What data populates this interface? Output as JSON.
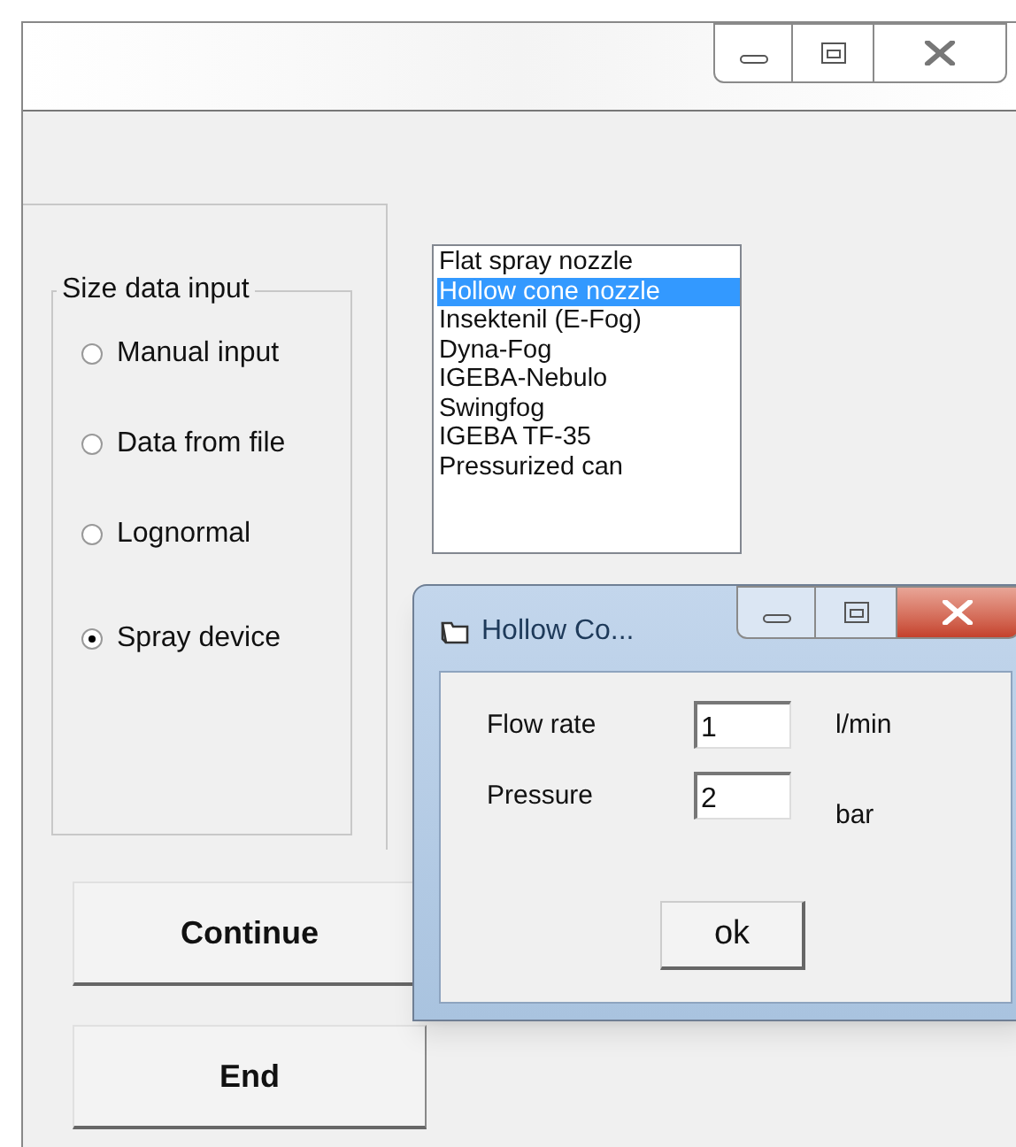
{
  "group": {
    "title": "Size data input",
    "options": [
      {
        "label": "Manual input",
        "selected": false
      },
      {
        "label": "Data from file",
        "selected": false
      },
      {
        "label": "Lognormal",
        "selected": false
      },
      {
        "label": "Spray device",
        "selected": true
      }
    ]
  },
  "list": {
    "items": [
      {
        "label": "Flat spray nozzle",
        "selected": false
      },
      {
        "label": "Hollow cone nozzle",
        "selected": true
      },
      {
        "label": "Insektenil (E-Fog)",
        "selected": false
      },
      {
        "label": "Dyna-Fog",
        "selected": false
      },
      {
        "label": "IGEBA-Nebulo",
        "selected": false
      },
      {
        "label": "Swingfog",
        "selected": false
      },
      {
        "label": "IGEBA TF-35",
        "selected": false
      },
      {
        "label": "Pressurized can",
        "selected": false
      }
    ]
  },
  "buttons": [
    "Continue",
    "End"
  ],
  "dialog": {
    "title": "Hollow Co...",
    "fields": [
      {
        "label": "Flow rate",
        "value": "1",
        "unit": "l/min"
      },
      {
        "label": "Pressure",
        "value": "2",
        "unit": "bar"
      }
    ],
    "ok": "ok"
  }
}
